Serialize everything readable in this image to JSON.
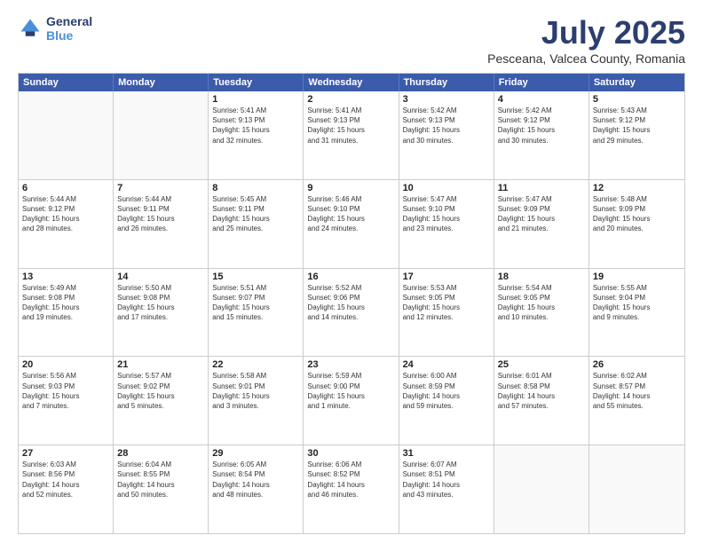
{
  "header": {
    "logo": {
      "general": "General",
      "blue": "Blue"
    },
    "title": "July 2025",
    "subtitle": "Pesceana, Valcea County, Romania"
  },
  "calendar": {
    "days_of_week": [
      "Sunday",
      "Monday",
      "Tuesday",
      "Wednesday",
      "Thursday",
      "Friday",
      "Saturday"
    ],
    "weeks": [
      [
        {
          "day": "",
          "empty": true,
          "text": ""
        },
        {
          "day": "",
          "empty": true,
          "text": ""
        },
        {
          "day": "1",
          "text": "Sunrise: 5:41 AM\nSunset: 9:13 PM\nDaylight: 15 hours\nand 32 minutes."
        },
        {
          "day": "2",
          "text": "Sunrise: 5:41 AM\nSunset: 9:13 PM\nDaylight: 15 hours\nand 31 minutes."
        },
        {
          "day": "3",
          "text": "Sunrise: 5:42 AM\nSunset: 9:13 PM\nDaylight: 15 hours\nand 30 minutes."
        },
        {
          "day": "4",
          "text": "Sunrise: 5:42 AM\nSunset: 9:12 PM\nDaylight: 15 hours\nand 30 minutes."
        },
        {
          "day": "5",
          "text": "Sunrise: 5:43 AM\nSunset: 9:12 PM\nDaylight: 15 hours\nand 29 minutes."
        }
      ],
      [
        {
          "day": "6",
          "text": "Sunrise: 5:44 AM\nSunset: 9:12 PM\nDaylight: 15 hours\nand 28 minutes."
        },
        {
          "day": "7",
          "text": "Sunrise: 5:44 AM\nSunset: 9:11 PM\nDaylight: 15 hours\nand 26 minutes."
        },
        {
          "day": "8",
          "text": "Sunrise: 5:45 AM\nSunset: 9:11 PM\nDaylight: 15 hours\nand 25 minutes."
        },
        {
          "day": "9",
          "text": "Sunrise: 5:46 AM\nSunset: 9:10 PM\nDaylight: 15 hours\nand 24 minutes."
        },
        {
          "day": "10",
          "text": "Sunrise: 5:47 AM\nSunset: 9:10 PM\nDaylight: 15 hours\nand 23 minutes."
        },
        {
          "day": "11",
          "text": "Sunrise: 5:47 AM\nSunset: 9:09 PM\nDaylight: 15 hours\nand 21 minutes."
        },
        {
          "day": "12",
          "text": "Sunrise: 5:48 AM\nSunset: 9:09 PM\nDaylight: 15 hours\nand 20 minutes."
        }
      ],
      [
        {
          "day": "13",
          "text": "Sunrise: 5:49 AM\nSunset: 9:08 PM\nDaylight: 15 hours\nand 19 minutes."
        },
        {
          "day": "14",
          "text": "Sunrise: 5:50 AM\nSunset: 9:08 PM\nDaylight: 15 hours\nand 17 minutes."
        },
        {
          "day": "15",
          "text": "Sunrise: 5:51 AM\nSunset: 9:07 PM\nDaylight: 15 hours\nand 15 minutes."
        },
        {
          "day": "16",
          "text": "Sunrise: 5:52 AM\nSunset: 9:06 PM\nDaylight: 15 hours\nand 14 minutes."
        },
        {
          "day": "17",
          "text": "Sunrise: 5:53 AM\nSunset: 9:05 PM\nDaylight: 15 hours\nand 12 minutes."
        },
        {
          "day": "18",
          "text": "Sunrise: 5:54 AM\nSunset: 9:05 PM\nDaylight: 15 hours\nand 10 minutes."
        },
        {
          "day": "19",
          "text": "Sunrise: 5:55 AM\nSunset: 9:04 PM\nDaylight: 15 hours\nand 9 minutes."
        }
      ],
      [
        {
          "day": "20",
          "text": "Sunrise: 5:56 AM\nSunset: 9:03 PM\nDaylight: 15 hours\nand 7 minutes."
        },
        {
          "day": "21",
          "text": "Sunrise: 5:57 AM\nSunset: 9:02 PM\nDaylight: 15 hours\nand 5 minutes."
        },
        {
          "day": "22",
          "text": "Sunrise: 5:58 AM\nSunset: 9:01 PM\nDaylight: 15 hours\nand 3 minutes."
        },
        {
          "day": "23",
          "text": "Sunrise: 5:59 AM\nSunset: 9:00 PM\nDaylight: 15 hours\nand 1 minute."
        },
        {
          "day": "24",
          "text": "Sunrise: 6:00 AM\nSunset: 8:59 PM\nDaylight: 14 hours\nand 59 minutes."
        },
        {
          "day": "25",
          "text": "Sunrise: 6:01 AM\nSunset: 8:58 PM\nDaylight: 14 hours\nand 57 minutes."
        },
        {
          "day": "26",
          "text": "Sunrise: 6:02 AM\nSunset: 8:57 PM\nDaylight: 14 hours\nand 55 minutes."
        }
      ],
      [
        {
          "day": "27",
          "text": "Sunrise: 6:03 AM\nSunset: 8:56 PM\nDaylight: 14 hours\nand 52 minutes."
        },
        {
          "day": "28",
          "text": "Sunrise: 6:04 AM\nSunset: 8:55 PM\nDaylight: 14 hours\nand 50 minutes."
        },
        {
          "day": "29",
          "text": "Sunrise: 6:05 AM\nSunset: 8:54 PM\nDaylight: 14 hours\nand 48 minutes."
        },
        {
          "day": "30",
          "text": "Sunrise: 6:06 AM\nSunset: 8:52 PM\nDaylight: 14 hours\nand 46 minutes."
        },
        {
          "day": "31",
          "text": "Sunrise: 6:07 AM\nSunset: 8:51 PM\nDaylight: 14 hours\nand 43 minutes."
        },
        {
          "day": "",
          "empty": true,
          "text": ""
        },
        {
          "day": "",
          "empty": true,
          "text": ""
        }
      ]
    ]
  }
}
